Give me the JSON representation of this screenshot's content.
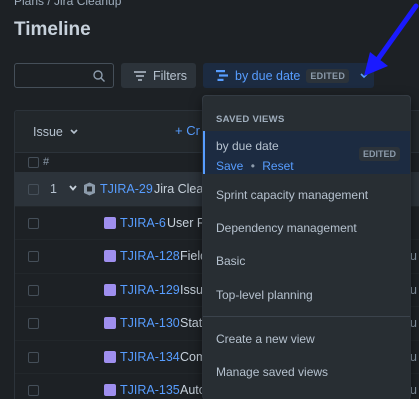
{
  "breadcrumb": {
    "text": "Plans  /  Jira Cleanup"
  },
  "page": {
    "title": "Timeline"
  },
  "search": {
    "placeholder": ""
  },
  "toolbar": {
    "filters_label": "Filters",
    "view_label": "by due date",
    "view_badge": "EDITED"
  },
  "table": {
    "issue_header": "Issue",
    "create_label": "+ Cr",
    "hash_label": "#",
    "rows": [
      {
        "num": "1",
        "key": "TJIRA-29",
        "summary": "Jira Clean",
        "type": "epic"
      },
      {
        "num": "",
        "key": "TJIRA-6",
        "summary": "User Ro",
        "type": "story",
        "edge": ""
      },
      {
        "num": "",
        "key": "TJIRA-128",
        "summary": "Field",
        "type": "story",
        "edge": "u"
      },
      {
        "num": "",
        "key": "TJIRA-129",
        "summary": "Issue",
        "type": "story",
        "edge": "u"
      },
      {
        "num": "",
        "key": "TJIRA-130",
        "summary": "Statu",
        "type": "story",
        "edge": "u"
      },
      {
        "num": "",
        "key": "TJIRA-134",
        "summary": "Com",
        "type": "story",
        "edge": "u"
      },
      {
        "num": "",
        "key": "TJIRA-135",
        "summary": "Autom",
        "type": "story",
        "edge": "u"
      }
    ]
  },
  "dropdown": {
    "section_title": "SAVED VIEWS",
    "active_view": {
      "name": "by due date",
      "badge": "EDITED",
      "save_label": "Save",
      "separator": "•",
      "reset_label": "Reset"
    },
    "views": [
      "Sprint capacity management",
      "Dependency management",
      "Basic",
      "Top-level planning"
    ],
    "actions": [
      "Create a new view",
      "Manage saved views"
    ]
  },
  "colors": {
    "background": "#1d2125",
    "accent": "#579dff",
    "story_icon": "#9f8fef",
    "annotation_arrow": "#1a1aff"
  }
}
